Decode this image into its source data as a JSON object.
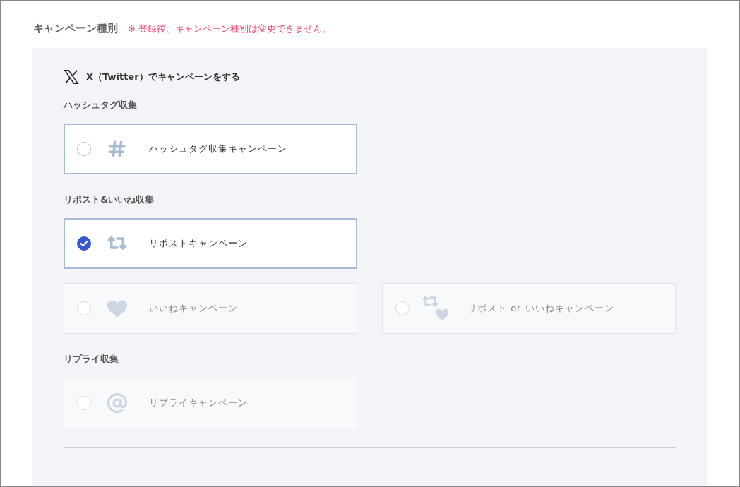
{
  "section": {
    "label": "キャンペーン種別",
    "notice": "※ 登録後、キャンペーン種別は変更できません。"
  },
  "platform": {
    "title": "X（Twitter）でキャンペーンをする"
  },
  "groups": [
    {
      "label": "ハッシュタグ収集",
      "rows": [
        [
          {
            "kind": "hashtag",
            "label": "ハッシュタグ収集キャンペーン",
            "selected": false,
            "disabled": false
          }
        ]
      ]
    },
    {
      "label": "リポスト&いいね収集",
      "rows": [
        [
          {
            "kind": "repost",
            "label": "リポストキャンペーン",
            "selected": true,
            "disabled": false
          }
        ],
        [
          {
            "kind": "like",
            "label": "いいねキャンペーン",
            "selected": false,
            "disabled": true
          },
          {
            "kind": "repost-like",
            "label": "リポスト or いいねキャンペーン",
            "selected": false,
            "disabled": true
          }
        ]
      ]
    },
    {
      "label": "リプライ収集",
      "rows": [
        [
          {
            "kind": "reply",
            "label": "リプライキャンペーン",
            "selected": false,
            "disabled": true
          }
        ]
      ]
    }
  ]
}
